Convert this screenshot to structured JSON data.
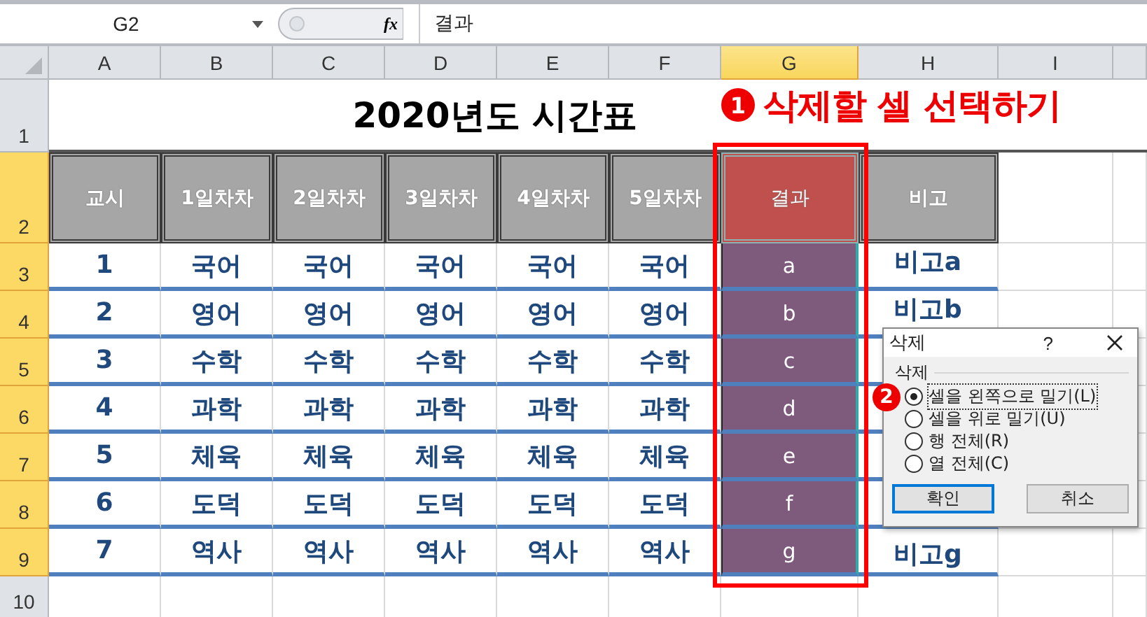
{
  "formula_bar": {
    "name_box": "G2",
    "function_label": "fx",
    "value": "결과"
  },
  "columns": [
    {
      "label": "A",
      "selected": false
    },
    {
      "label": "B",
      "selected": false
    },
    {
      "label": "C",
      "selected": false
    },
    {
      "label": "D",
      "selected": false
    },
    {
      "label": "E",
      "selected": false
    },
    {
      "label": "F",
      "selected": false
    },
    {
      "label": "G",
      "selected": true
    },
    {
      "label": "H",
      "selected": false
    },
    {
      "label": "I",
      "selected": false
    }
  ],
  "row_numbers": [
    {
      "label": "1",
      "selected": false
    },
    {
      "label": "2",
      "selected": true
    },
    {
      "label": "3",
      "selected": true
    },
    {
      "label": "4",
      "selected": true
    },
    {
      "label": "5",
      "selected": true
    },
    {
      "label": "6",
      "selected": true
    },
    {
      "label": "7",
      "selected": true
    },
    {
      "label": "8",
      "selected": true
    },
    {
      "label": "9",
      "selected": true
    },
    {
      "label": "10",
      "selected": false
    }
  ],
  "title": "2020년도 시간표",
  "annotation": {
    "badge": "1",
    "text": "삭제할 셀 선택하기"
  },
  "table": {
    "header": [
      {
        "label": "교시",
        "highlighted": false
      },
      {
        "label": "1일차차",
        "highlighted": false
      },
      {
        "label": "2일차차",
        "highlighted": false
      },
      {
        "label": "3일차차",
        "highlighted": false
      },
      {
        "label": "4일차차",
        "highlighted": false
      },
      {
        "label": "5일차차",
        "highlighted": false
      },
      {
        "label": "결과",
        "highlighted": true
      },
      {
        "label": "비고",
        "highlighted": false
      }
    ],
    "rows": [
      {
        "cells": [
          "1",
          "국어",
          "국어",
          "국어",
          "국어",
          "국어",
          "a",
          "비고a"
        ]
      },
      {
        "cells": [
          "2",
          "영어",
          "영어",
          "영어",
          "영어",
          "영어",
          "b",
          "비고b"
        ]
      },
      {
        "cells": [
          "3",
          "수학",
          "수학",
          "수학",
          "수학",
          "수학",
          "c"
        ]
      },
      {
        "cells": [
          "4",
          "과학",
          "과학",
          "과학",
          "과학",
          "과학",
          "d"
        ]
      },
      {
        "cells": [
          "5",
          "체육",
          "체육",
          "체육",
          "체육",
          "체육",
          "e"
        ]
      },
      {
        "cells": [
          "6",
          "도덕",
          "도덕",
          "도덕",
          "도덕",
          "도덕",
          "f"
        ]
      },
      {
        "cells": [
          "7",
          "역사",
          "역사",
          "역사",
          "역사",
          "역사",
          "g",
          "비고g"
        ]
      }
    ]
  },
  "dialog": {
    "title": "삭제",
    "help": "?",
    "group_label": "삭제",
    "badge": "2",
    "options": [
      {
        "label": "셀을 왼쪽으로 밀기(L)",
        "selected": true
      },
      {
        "label": "셀을 위로 밀기(U)",
        "selected": false
      },
      {
        "label": "행 전체(R)",
        "selected": false
      },
      {
        "label": "열 전체(C)",
        "selected": false
      }
    ],
    "buttons": [
      {
        "label": "확인",
        "default": true
      },
      {
        "label": "취소",
        "default": false
      }
    ]
  }
}
